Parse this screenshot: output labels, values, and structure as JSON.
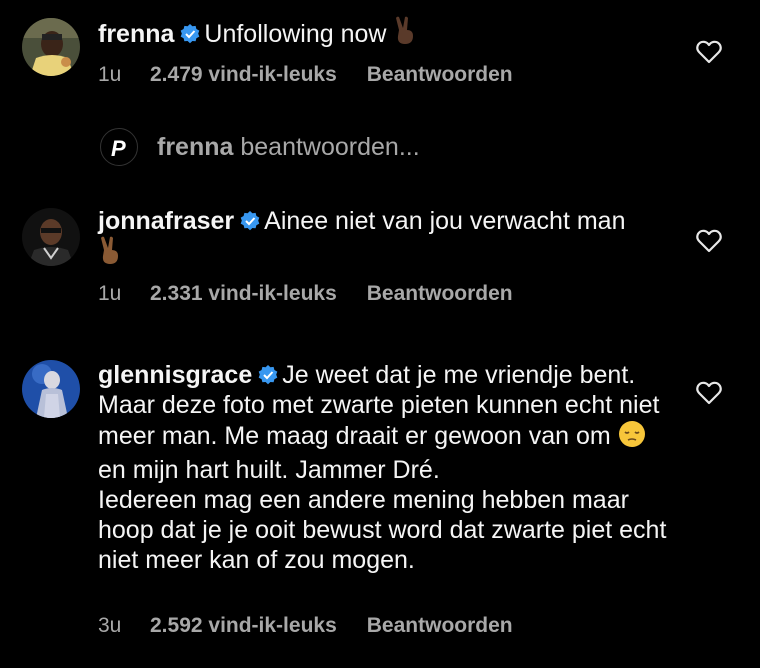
{
  "verified_color": "#3897f0",
  "text_color": "#f5f5f5",
  "muted_color": "#a8a8a8",
  "comments": [
    {
      "username": "frenna",
      "text": "Unfollowing now",
      "emoji": "victory-hand-dark",
      "time": "1u",
      "likes": "2.479 vind-ik-leuks",
      "reply_label": "Beantwoorden"
    },
    {
      "username": "jonnafraser",
      "text": "Ainee niet van jou verwacht man",
      "emoji": "victory-hand-medium",
      "time": "1u",
      "likes": "2.331 vind-ik-leuks",
      "reply_label": "Beantwoorden"
    },
    {
      "username": "glennisgrace",
      "text_part1": "Je weet dat je me vriendje bent. Maar deze foto met zwarte pieten kunnen echt niet meer man. Me maag draait er gewoon van om",
      "emoji": "pensive-face",
      "text_part2": " en mijn hart huilt. Jammer Dré.",
      "text_part3": "Iedereen mag een andere mening hebben maar hoop dat je je ooit bewust word dat zwarte piet echt niet meer kan of zou mogen.",
      "time": "3u",
      "likes": "2.592 vind-ik-leuks",
      "reply_label": "Beantwoorden"
    }
  ],
  "reply_composer": {
    "username": "frenna",
    "placeholder_suffix": "beantwoorden..."
  }
}
